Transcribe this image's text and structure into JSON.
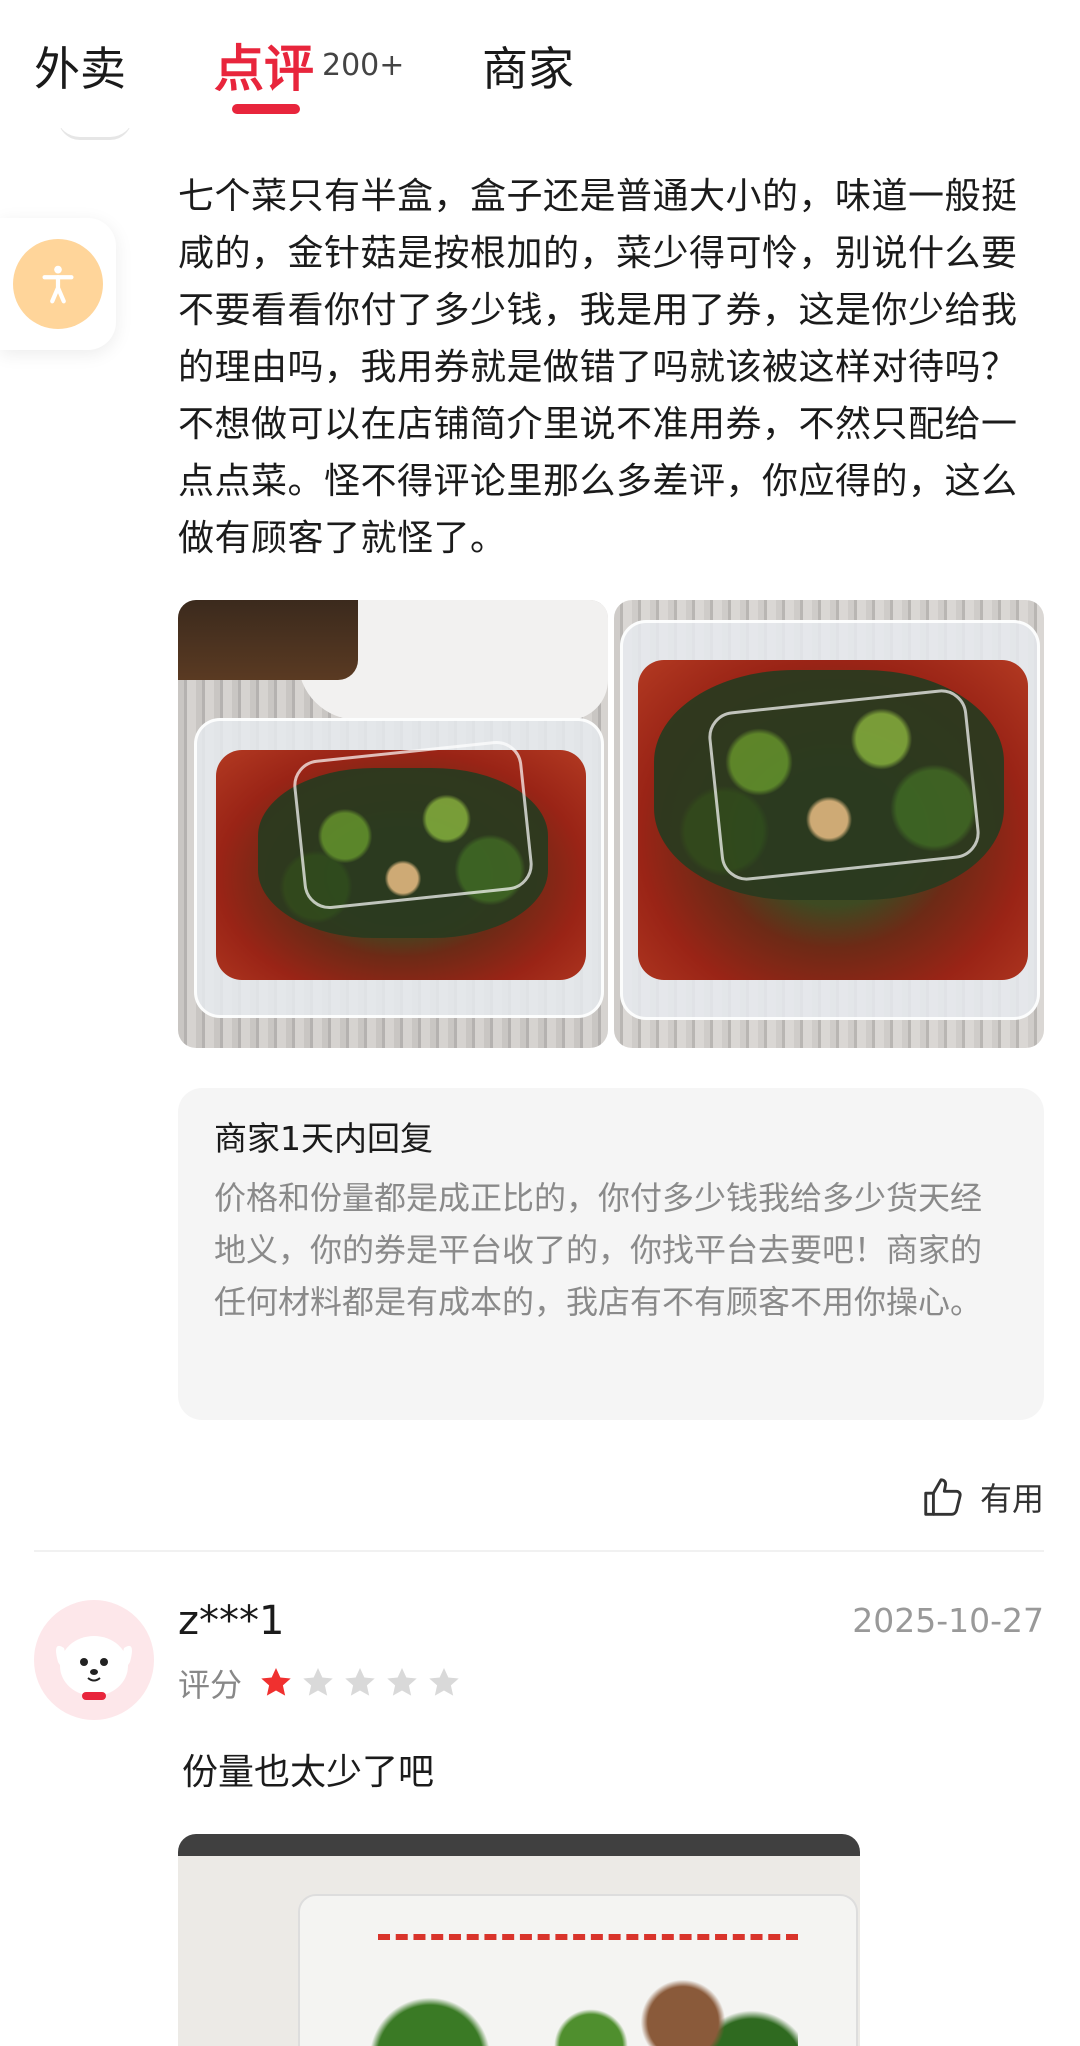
{
  "tabs": {
    "waimai": "外卖",
    "dianping": "点评",
    "dianping_count": "200+",
    "shangjia": "商家"
  },
  "colors": {
    "accent": "#e8253c",
    "star_active": "#f0302f",
    "star_inactive": "#d9d9d9",
    "a11y_bg": "#ffd59a"
  },
  "review1": {
    "text": " 七个菜只有半盒，盒子还是普通大小的，味道一般挺咸的，金针菇是按根加的，菜少得可怜，别说什么要不要看看你付了多少钱，我是用了券，这是你少给我的理由吗，我用券就是做错了吗就该被这样对待吗？不想做可以在店铺简介里说不准用券，不然只配给一点点菜。怪不得评论里那么多差评，你应得的，这么做有顾客了就怪了。",
    "merchant_reply": {
      "title": "商家1天内回复",
      "text": "价格和份量都是成正比的，你付多少钱我给多少货天经地义，你的券是平台收了的，你找平台去要吧！商家的任何材料都是有成本的，我店有不有顾客不用你操心。"
    },
    "useful_label": "有用",
    "useful_icon": "thumbs-up-icon"
  },
  "review2": {
    "username": "z***1",
    "date": "2025-10-27",
    "rating_label": "评分",
    "rating": 1,
    "rating_max": 5,
    "text": " 份量也太少了吧"
  }
}
